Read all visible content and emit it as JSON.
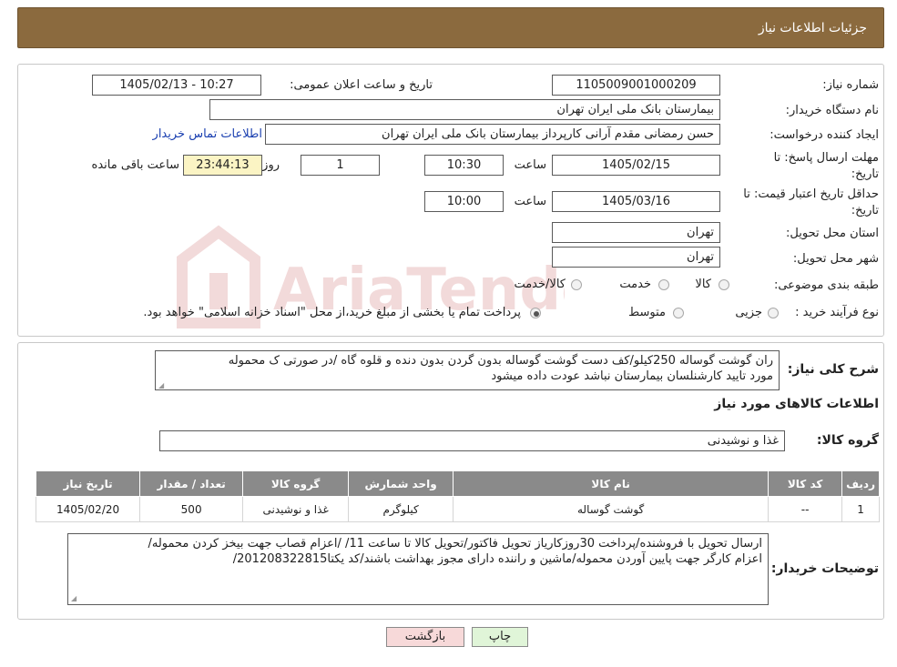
{
  "header": {
    "title": "جزئیات اطلاعات نیاز"
  },
  "form": {
    "need_number_label": "شماره نیاز:",
    "need_number": "1105009001000209",
    "announce_label": "تاریخ و ساعت اعلان عمومی:",
    "announce_value": "1405/02/13 - 10:27",
    "buyer_org_label": "نام دستگاه خریدار:",
    "buyer_org": "بیمارستان بانک ملی ایران تهران",
    "requester_label": "ایجاد کننده درخواست:",
    "requester": "حسن رمضانی مقدم آرانی کارپرداز بیمارستان بانک ملی ایران تهران",
    "contact_link": "اطلاعات تماس خریدار",
    "deadline_label_1": "مهلت ارسال پاسخ: تا",
    "deadline_label_2": "تاریخ:",
    "deadline_date": "1405/02/15",
    "time_label": "ساعت",
    "deadline_time": "10:30",
    "days_value": "1",
    "days_label": "روز و",
    "remaining_time": "23:44:13",
    "remaining_label": "ساعت باقی مانده",
    "validity_label_1": "حداقل تاریخ اعتبار قیمت: تا",
    "validity_label_2": "تاریخ:",
    "validity_date": "1405/03/16",
    "validity_time": "10:00",
    "province_label": "استان محل تحویل:",
    "province": "تهران",
    "city_label": "شهر محل تحویل:",
    "city": "تهران",
    "category_label": "طبقه بندی موضوعی:",
    "category_options": [
      "کالا",
      "خدمت",
      "کالا/خدمت"
    ],
    "process_label": "نوع فرآیند خرید :",
    "process_options": [
      "جزیی",
      "متوسط"
    ],
    "process_note": "پرداخت تمام یا بخشی از مبلغ خرید،از محل \"اسناد خزانه اسلامی\" خواهد بود."
  },
  "description": {
    "label": "شرح کلی نیاز:",
    "line1": "ران گوشت گوساله 250کیلو/کف دست گوشت گوساله بدون گردن بدون دنده و قلوه گاه /در صورتی ک محموله",
    "line2": "مورد تایید کارشنلسان بیمارستان نباشد عودت داده میشود"
  },
  "goods": {
    "section_title": "اطلاعات کالاهای مورد نیاز",
    "group_label": "گروه کالا:",
    "group_value": "غذا و نوشیدنی",
    "columns": [
      "ردیف",
      "کد کالا",
      "نام کالا",
      "واحد شمارش",
      "گروه کالا",
      "تعداد / مقدار",
      "تاریخ نیاز"
    ],
    "rows": [
      [
        "1",
        "--",
        "گوشت گوساله",
        "کیلوگرم",
        "غذا و نوشیدنی",
        "500",
        "1405/02/20"
      ]
    ]
  },
  "buyer_notes": {
    "label": "توضیحات خریدار:",
    "line1": "ارسال تحویل با فروشنده/پرداخت 30روزکاریاز تحویل فاکتور/تحویل کالا تا ساعت 11/ /اعزام قصاب جهت بیخز کردن محموله/",
    "line2": "اعزام کارگر جهت پایین آوردن محموله/ماشین و راننده دارای مجوز بهداشت باشند/کد یکتا201208322815/"
  },
  "buttons": {
    "print": "چاپ",
    "back": "بازگشت"
  },
  "watermark": {
    "text": "AriaTender.neT"
  },
  "colors": {
    "header_bg": "#8b6a3e",
    "table_header_bg": "#8a8a8a",
    "back_button_bg": "#f7d9d9",
    "print_button_bg": "#e0f5d8",
    "remaining_bg": "#fbf4c4",
    "link": "#1a3fb0"
  }
}
